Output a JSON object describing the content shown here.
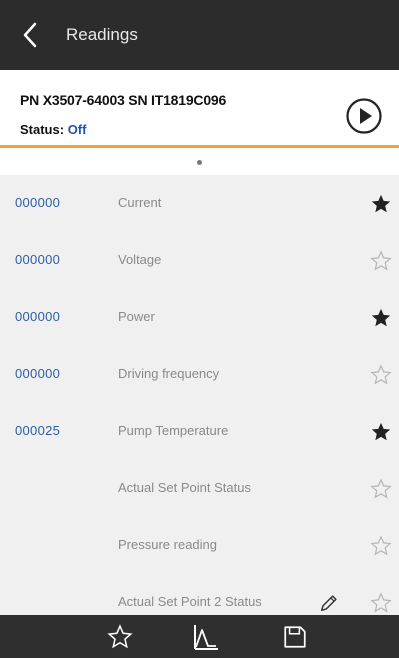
{
  "header": {
    "title": "Readings"
  },
  "device": {
    "pn_sn": "PN X3507-64003 SN IT1819C096",
    "status_label": "Status:",
    "status_value": "Off"
  },
  "readings": [
    {
      "value": "000000",
      "label": "Current",
      "favorite": true
    },
    {
      "value": "000000",
      "label": "Voltage",
      "favorite": false
    },
    {
      "value": "000000",
      "label": "Power",
      "favorite": true
    },
    {
      "value": "000000",
      "label": "Driving frequency",
      "favorite": false
    },
    {
      "value": "000025",
      "label": "Pump Temperature",
      "favorite": true
    },
    {
      "value": "",
      "label": "Actual Set Point Status",
      "favorite": false
    },
    {
      "value": "",
      "label": "Pressure reading",
      "favorite": false
    },
    {
      "value": "",
      "label": "Actual Set Point 2 Status",
      "favorite": false,
      "editable": true
    }
  ],
  "bottom_nav": [
    {
      "icon": "star-outline-icon"
    },
    {
      "icon": "chart-icon"
    },
    {
      "icon": "save-icon"
    }
  ],
  "colors": {
    "topbar": "#2c2c2c",
    "accent": "#f0a23a",
    "value_blue": "#2b5fa6",
    "status_blue": "#1d54b0"
  }
}
